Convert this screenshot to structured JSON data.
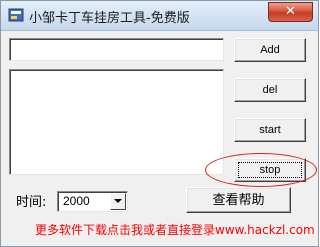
{
  "window": {
    "title": "小邹卡丁车挂房工具-免费版",
    "close_glyph": "✕"
  },
  "main": {
    "input_value": "",
    "list_items": []
  },
  "buttons": {
    "add": "Add",
    "del": "del",
    "start": "start",
    "stop": "stop",
    "help": "查看帮助"
  },
  "time": {
    "label": "时间:",
    "selected": "2000"
  },
  "footer": {
    "link_text": "更多软件下载点击我或者直接登录www.hackzl.com"
  },
  "icons": {
    "app": "app-icon",
    "close": "close-icon",
    "dropdown": "chevron-down-icon"
  },
  "colors": {
    "footer_link": "#ff0000",
    "highlight_ellipse": "#d62020",
    "close_button": "#c43c24"
  }
}
